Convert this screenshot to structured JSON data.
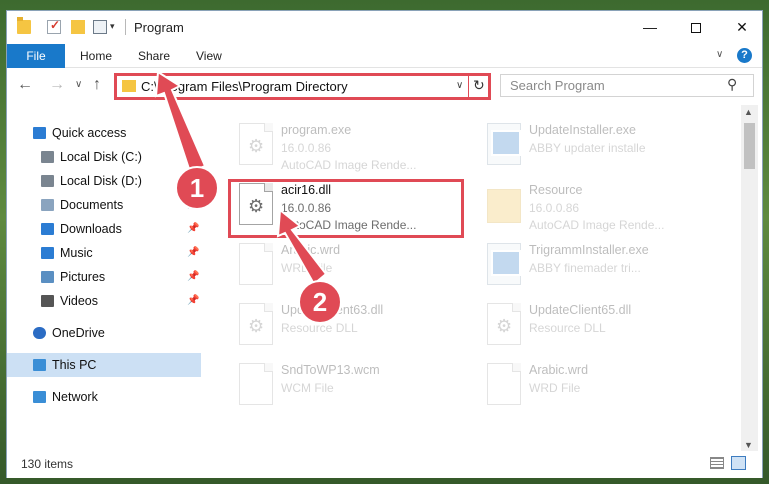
{
  "window": {
    "title": "Program",
    "minimize_glyph": "—",
    "close_glyph": "✕"
  },
  "ribbon": {
    "tabs": [
      "File",
      "Home",
      "Share",
      "View"
    ],
    "help_glyph": "?"
  },
  "nav": {
    "back_glyph": "←",
    "forward_glyph": "→",
    "up_glyph": "↑",
    "address": "C:\\Program Files\\Program Directory",
    "search_placeholder": "Search Program"
  },
  "sidebar": {
    "items": [
      {
        "label": "Quick access",
        "icon": "star-icon",
        "pinned": false
      },
      {
        "label": "Local Disk (C:)",
        "icon": "drive-icon",
        "pinned": true
      },
      {
        "label": "Local Disk (D:)",
        "icon": "drive-icon",
        "pinned": true
      },
      {
        "label": "Documents",
        "icon": "documents-icon",
        "pinned": true
      },
      {
        "label": "Downloads",
        "icon": "download-icon",
        "pinned": true
      },
      {
        "label": "Music",
        "icon": "music-icon",
        "pinned": true
      },
      {
        "label": "Pictures",
        "icon": "pictures-icon",
        "pinned": true
      },
      {
        "label": "Videos",
        "icon": "videos-icon",
        "pinned": true
      },
      {
        "label": "OneDrive",
        "icon": "cloud-icon",
        "pinned": false
      },
      {
        "label": "This PC",
        "icon": "computer-icon",
        "pinned": false,
        "selected": true
      },
      {
        "label": "Network",
        "icon": "network-icon",
        "pinned": false
      }
    ]
  },
  "files": [
    {
      "name": "program.exe",
      "line2": "16.0.0.86",
      "line3": "AutoCAD Image Rende...",
      "icon": "dll-gear-icon",
      "faded": true
    },
    {
      "name": "UpdateInstaller.exe",
      "line2": "ABBY updater installe",
      "line3": "",
      "icon": "exe-window-icon",
      "faded": true
    },
    {
      "name": "acir16.dll",
      "line2": "16.0.0.86",
      "line3": "AutoCAD Image Rende...",
      "icon": "dll-gear-icon",
      "faded": false
    },
    {
      "name": "Resource",
      "line2": "16.0.0.86",
      "line3": "AutoCAD Image Rende...",
      "icon": "folder-icon",
      "faded": true
    },
    {
      "name": "Arabic.wrd",
      "line2": "WRD File",
      "line3": "",
      "icon": "blank-doc-icon",
      "faded": true
    },
    {
      "name": "TrigrammInstaller.exe",
      "line2": "ABBY finemader tri...",
      "line3": "",
      "icon": "exe-window-icon",
      "faded": true
    },
    {
      "name": "UpdateClient63.dll",
      "line2": "Resource DLL",
      "line3": "",
      "icon": "dll-gear-icon",
      "faded": true
    },
    {
      "name": "UpdateClient65.dll",
      "line2": "Resource DLL",
      "line3": "",
      "icon": "dll-gear-icon",
      "faded": true
    },
    {
      "name": "SndToWP13.wcm",
      "line2": "WCM File",
      "line3": "",
      "icon": "blank-doc-icon",
      "faded": true
    },
    {
      "name": "Arabic.wrd",
      "line2": "WRD File",
      "line3": "",
      "icon": "blank-doc-icon",
      "faded": true
    }
  ],
  "status": {
    "item_count": "130 items"
  },
  "annotations": {
    "step1": "1",
    "step2": "2",
    "color": "#e04a55"
  }
}
